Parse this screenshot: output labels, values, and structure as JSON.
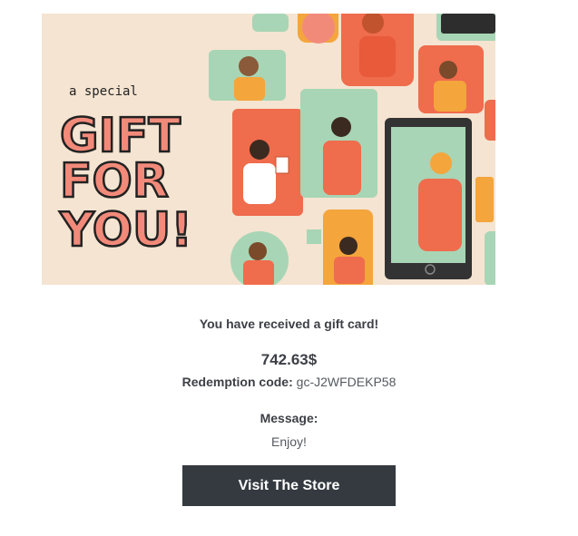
{
  "banner": {
    "subtitle": "a special",
    "title_line1": "GIFT",
    "title_line2": "FOR",
    "title_line3": "YOU!"
  },
  "gift": {
    "headline": "You have received a gift card!",
    "amount": "742.63$",
    "code_label": "Redemption code:",
    "code_value": "gc-J2WFDEKP58",
    "message_label": "Message:",
    "message_text": "Enjoy!"
  },
  "cta": {
    "label": "Visit The Store"
  },
  "colors": {
    "banner_bg": "#f4e4d1",
    "coral": "#ef6c4d",
    "salmon": "#f28a7a",
    "mint": "#a8d5b5",
    "mustard": "#f4a53c",
    "button_bg": "#343a40"
  }
}
